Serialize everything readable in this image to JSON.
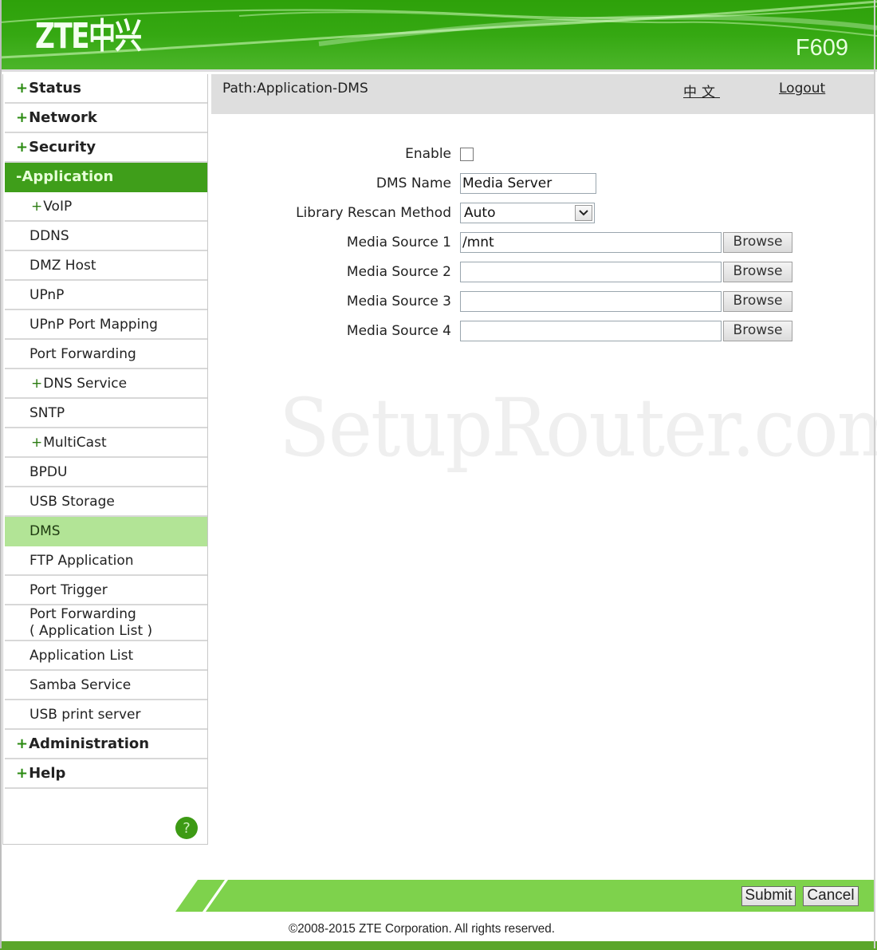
{
  "header": {
    "logo": "ZTE中兴",
    "model": "F609",
    "colors": {
      "header_green": "#35a812",
      "accent_green": "#3f9e1a",
      "selected_green": "#b2e496",
      "footer_green": "#7ed24c"
    }
  },
  "sidebar": {
    "items": [
      {
        "label": "Status",
        "prefix": "+",
        "level": "top"
      },
      {
        "label": "Network",
        "prefix": "+",
        "level": "top"
      },
      {
        "label": "Security",
        "prefix": "+",
        "level": "top"
      },
      {
        "label": "Application",
        "prefix": "-",
        "level": "top",
        "expanded": true
      },
      {
        "label": "VoIP",
        "prefix": "+",
        "level": "sub"
      },
      {
        "label": "DDNS",
        "prefix": "",
        "level": "sub"
      },
      {
        "label": "DMZ Host",
        "prefix": "",
        "level": "sub"
      },
      {
        "label": "UPnP",
        "prefix": "",
        "level": "sub"
      },
      {
        "label": "UPnP Port Mapping",
        "prefix": "",
        "level": "sub"
      },
      {
        "label": "Port Forwarding",
        "prefix": "",
        "level": "sub"
      },
      {
        "label": "DNS Service",
        "prefix": "+",
        "level": "sub"
      },
      {
        "label": "SNTP",
        "prefix": "",
        "level": "sub"
      },
      {
        "label": "MultiCast",
        "prefix": "+",
        "level": "sub"
      },
      {
        "label": "BPDU",
        "prefix": "",
        "level": "sub"
      },
      {
        "label": "USB Storage",
        "prefix": "",
        "level": "sub"
      },
      {
        "label": "DMS",
        "prefix": "",
        "level": "sub",
        "selected": true
      },
      {
        "label": "FTP Application",
        "prefix": "",
        "level": "sub"
      },
      {
        "label": "Port Trigger",
        "prefix": "",
        "level": "sub"
      },
      {
        "label": "Port Forwarding",
        "label2": "( Application List )",
        "prefix": "",
        "level": "sub"
      },
      {
        "label": "Application List",
        "prefix": "",
        "level": "sub"
      },
      {
        "label": "Samba Service",
        "prefix": "",
        "level": "sub"
      },
      {
        "label": "USB print server",
        "prefix": "",
        "level": "sub"
      },
      {
        "label": "Administration",
        "prefix": "+",
        "level": "top"
      },
      {
        "label": "Help",
        "prefix": "+",
        "level": "top"
      }
    ],
    "help_icon": "?"
  },
  "pathbar": {
    "path": "Path:Application-DMS",
    "language_link": "中文",
    "logout_link": "Logout"
  },
  "form": {
    "enable": {
      "label": "Enable",
      "checked": false
    },
    "dms_name": {
      "label": "DMS Name",
      "value": "Media Server"
    },
    "rescan": {
      "label": "Library Rescan Method",
      "selected": "Auto"
    },
    "sources": [
      {
        "label": "Media Source 1",
        "value": "/mnt",
        "button": "Browse"
      },
      {
        "label": "Media Source 2",
        "value": "",
        "button": "Browse"
      },
      {
        "label": "Media Source 3",
        "value": "",
        "button": "Browse"
      },
      {
        "label": "Media Source 4",
        "value": "",
        "button": "Browse"
      }
    ]
  },
  "watermark": "SetupRouter.com",
  "footer": {
    "submit": "Submit",
    "cancel": "Cancel",
    "copyright": "©2008-2015 ZTE Corporation. All rights reserved."
  }
}
